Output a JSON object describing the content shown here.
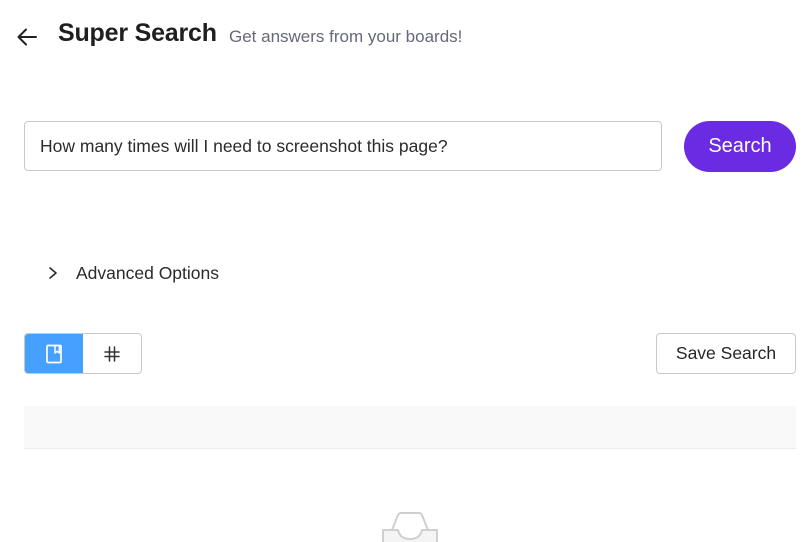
{
  "header": {
    "back_icon": "arrow-left-icon",
    "title": "Super Search",
    "subtitle": "Get answers from your boards!"
  },
  "search": {
    "value": "How many times will I need to screenshot this page?",
    "placeholder": "",
    "button_label": "Search",
    "accent_color": "#6a2be2"
  },
  "advanced": {
    "chevron_icon": "chevron-right-icon",
    "label": "Advanced Options",
    "expanded": false
  },
  "view_toggle": {
    "options": [
      {
        "icon": "document-view-icon",
        "active": true
      },
      {
        "icon": "hash-view-icon",
        "active": false
      }
    ],
    "active_color": "#45a0ff"
  },
  "save_search": {
    "label": "Save Search"
  },
  "results": {
    "empty_state_icon": "empty-inbox-icon"
  }
}
